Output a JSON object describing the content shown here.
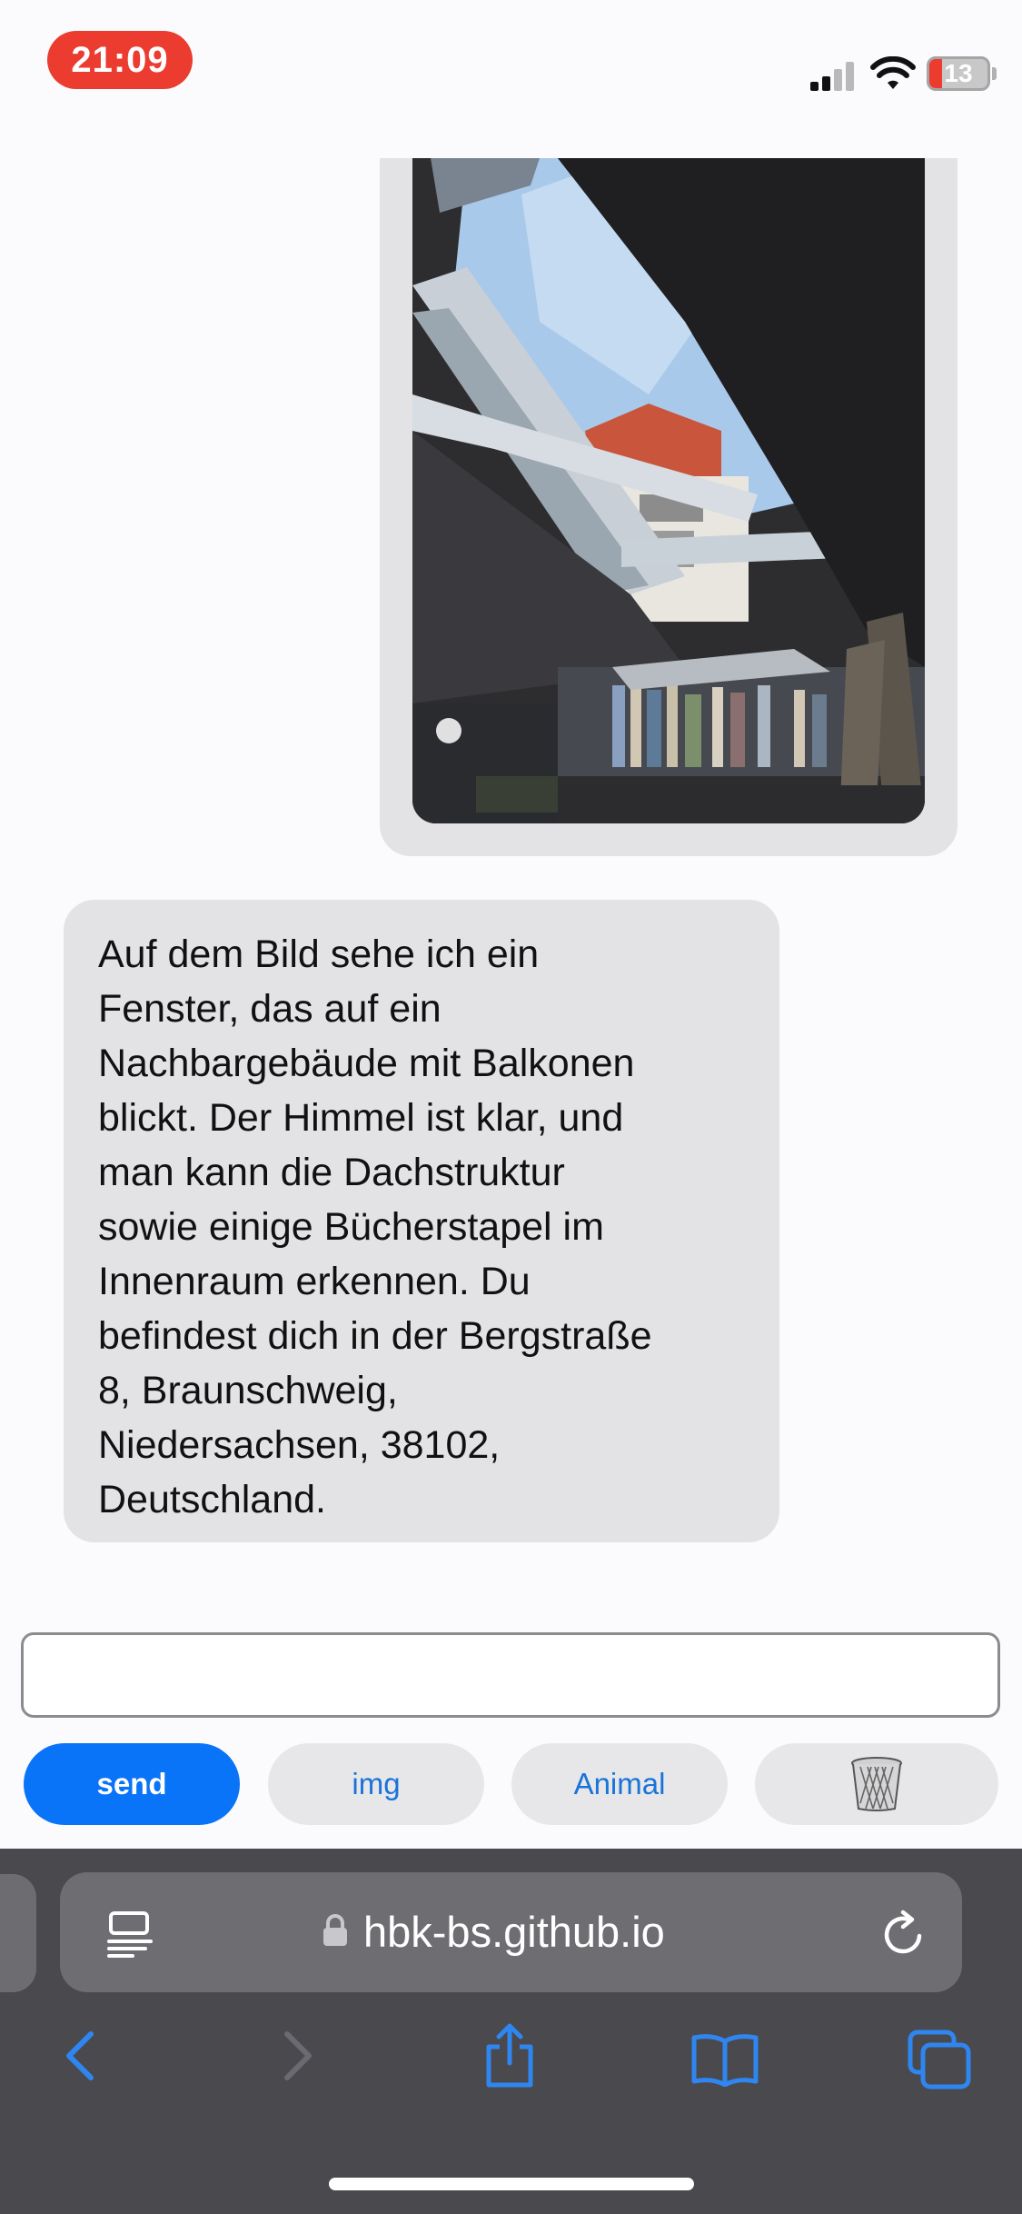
{
  "status_bar": {
    "time": "21:09",
    "battery_level": "13",
    "icons": [
      "signal-icon",
      "wifi-icon",
      "battery-icon"
    ]
  },
  "chat": {
    "messages": [
      {
        "role": "user",
        "type": "image",
        "image": "photo-window-neighbor-building"
      },
      {
        "role": "assistant",
        "type": "text",
        "lines": [
          "Auf dem Bild sehe ich ein",
          "Fenster, das auf ein",
          "Nachbargebäude mit Balkonen",
          "blickt. Der Himmel ist klar, und",
          "man kann die Dachstruktur",
          "sowie einige Bücherstapel im",
          "Innenraum erkennen. Du",
          "befindest dich in der Bergstraße",
          "8, Braunschweig,",
          "Niedersachsen, 38102,",
          "Deutschland."
        ]
      }
    ],
    "input": {
      "value": "",
      "placeholder": ""
    },
    "buttons": {
      "send_label": "send",
      "img_label": "img",
      "animal_label": "Animal",
      "trash_icon": "trash-icon"
    }
  },
  "browser": {
    "url": "hbk-bs.github.io",
    "icons": [
      "reader-icon",
      "lock-icon",
      "reload-icon",
      "back-icon",
      "forward-icon",
      "share-icon",
      "bookmarks-icon",
      "tabs-icon"
    ]
  },
  "colors": {
    "send_button": "#0a74f8",
    "link_blue": "#1a74d8",
    "bubble_gray": "#e3e3e6",
    "status_time_red": "#ec3b2f",
    "safari_bar": "#4a494d"
  }
}
